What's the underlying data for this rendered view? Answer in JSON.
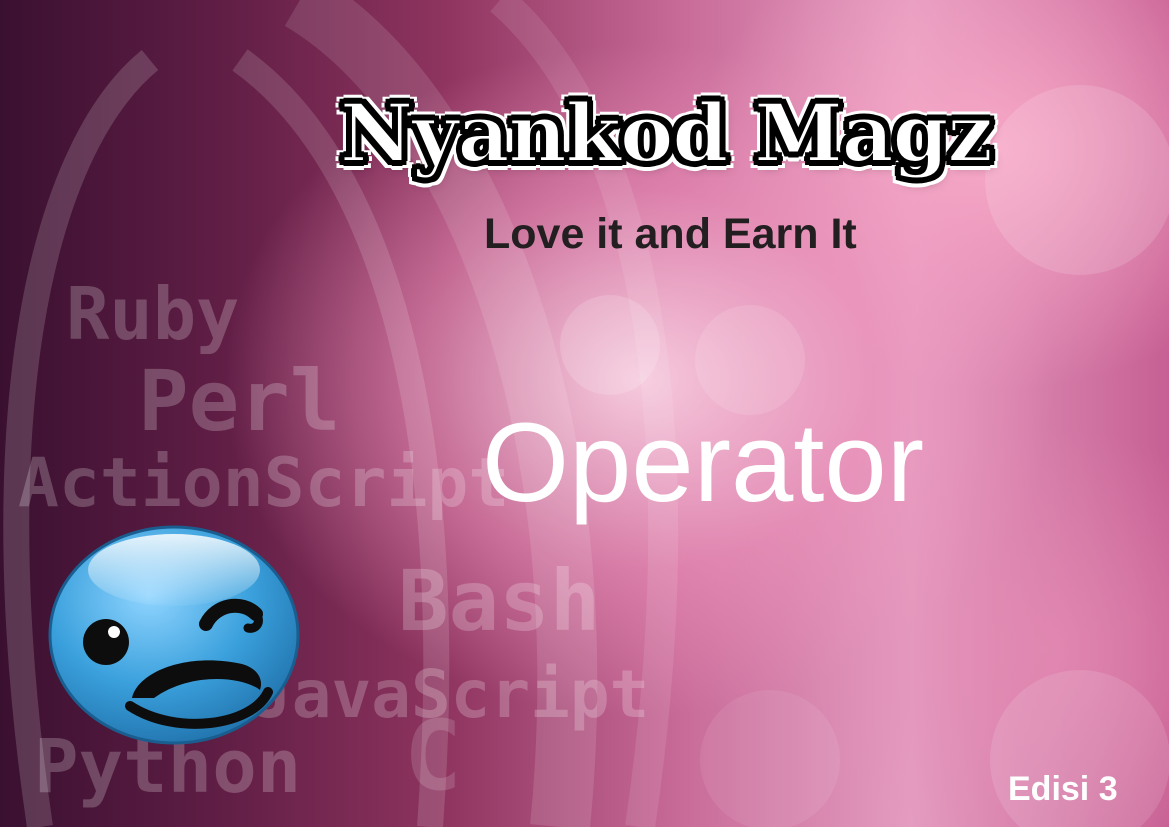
{
  "cover": {
    "brand": "Nyankod Magz",
    "tagline": "Love it and Earn It",
    "topic": "Operator",
    "edition": "Edisi 3",
    "mascot_icon": "winking-smiley-icon",
    "background_languages": [
      "Ruby",
      "Perl",
      "ActionScript",
      "Bash",
      "JavaScript",
      "Python",
      "C"
    ],
    "colors": {
      "background_dark": "#5e1d44",
      "background_light": "#e49cc0",
      "mascot_blue": "#3aa0dc",
      "tagline": "#231f20",
      "topic": "#ffffff"
    }
  }
}
